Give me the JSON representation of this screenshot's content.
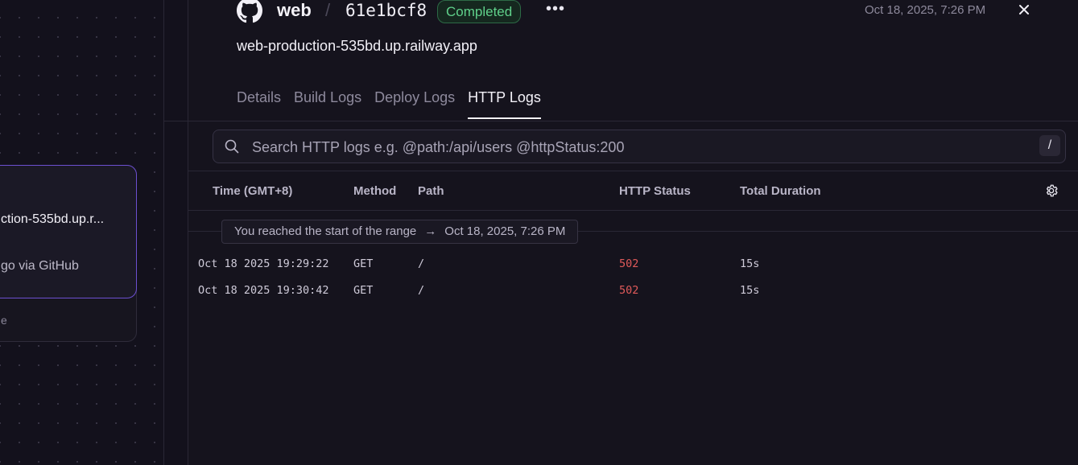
{
  "canvas": {
    "card": {
      "title": "ction-535bd.up.r...",
      "subtitle": "go via GitHub",
      "footer": "e"
    }
  },
  "header": {
    "source_icon": "github-icon",
    "service_name": "web",
    "separator": "/",
    "commit": "61e1bcf8",
    "status": "Completed",
    "status_color": "#5fd08a",
    "more_label": "•••",
    "timestamp": "Oct 18, 2025, 7:26 PM",
    "close_icon": "close-icon",
    "url": "web-production-535bd.up.railway.app"
  },
  "tabs": [
    {
      "label": "Details"
    },
    {
      "label": "Build Logs"
    },
    {
      "label": "Deploy Logs"
    },
    {
      "label": "HTTP Logs",
      "active": true
    }
  ],
  "search": {
    "placeholder": "Search HTTP logs e.g. @path:/api/users @httpStatus:200",
    "value": "",
    "shortcut": "/"
  },
  "table": {
    "columns": [
      "Time (GMT+8)",
      "Method",
      "Path",
      "HTTP Status",
      "Total Duration"
    ],
    "range_notice": {
      "text": "You reached the start of the range",
      "arrow": "→",
      "date": "Oct 18, 2025, 7:26 PM"
    },
    "rows": [
      {
        "time": "Oct 18 2025 19:29:22",
        "method": "GET",
        "path": "/",
        "status": "502",
        "duration": "15s"
      },
      {
        "time": "Oct 18 2025 19:30:42",
        "method": "GET",
        "path": "/",
        "status": "502",
        "duration": "15s"
      }
    ]
  },
  "colors": {
    "background": "#13111c",
    "panel": "#15131d",
    "accent_border": "#6c4fd0",
    "error": "#e05a5a"
  }
}
